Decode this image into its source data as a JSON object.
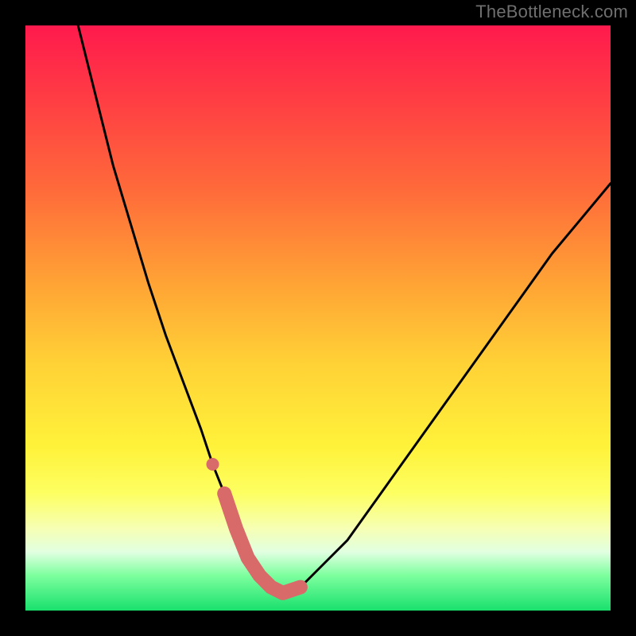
{
  "watermark": "TheBottleneck.com",
  "chart_data": {
    "type": "line",
    "title": "",
    "xlabel": "",
    "ylabel": "",
    "xlim": [
      0,
      100
    ],
    "ylim": [
      0,
      100
    ],
    "background": "rainbow-gradient (red→green)",
    "series": [
      {
        "name": "curve",
        "color": "#000000",
        "x": [
          9,
          12,
          15,
          18,
          21,
          24,
          27,
          30,
          32,
          34,
          36,
          38,
          40,
          42,
          44,
          47,
          50,
          55,
          60,
          65,
          70,
          75,
          80,
          85,
          90,
          95,
          100
        ],
        "values": [
          100,
          88,
          76,
          66,
          56,
          47,
          39,
          31,
          25,
          20,
          14,
          9,
          6,
          4,
          3,
          4,
          7,
          12,
          19,
          26,
          33,
          40,
          47,
          54,
          61,
          67,
          73
        ]
      },
      {
        "name": "highlight-band",
        "color": "#d86a6a",
        "x": [
          32,
          34,
          36,
          38,
          40,
          42,
          44,
          47
        ],
        "values": [
          25,
          20,
          14,
          9,
          6,
          4,
          3,
          4
        ]
      }
    ],
    "annotations": []
  }
}
